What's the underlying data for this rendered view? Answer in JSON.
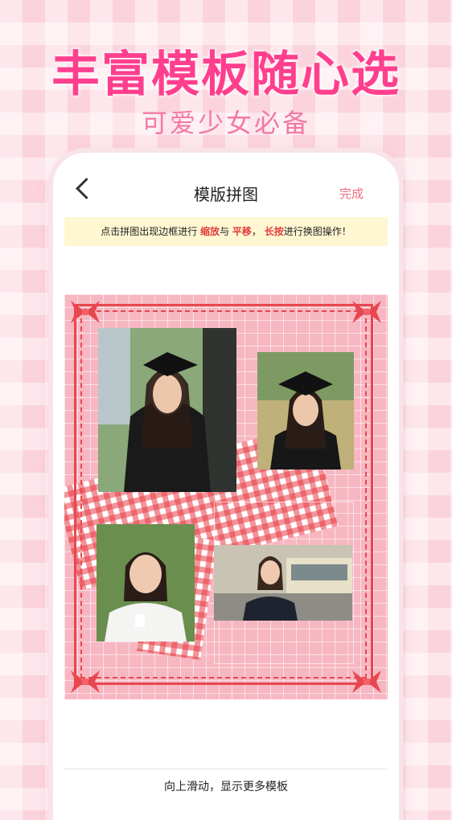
{
  "banner": {
    "headline": "丰富模板随心选",
    "subline": "可爱少女必备"
  },
  "navbar": {
    "title": "模版拼图",
    "done_label": "完成"
  },
  "tip": {
    "part1": "点击拼图出现边框进行 ",
    "zoom": "缩放",
    "part2": "与 ",
    "move": "平移",
    "part3": "， ",
    "longpress": "长按",
    "part4": "进行换图操作！"
  },
  "footer": {
    "hint": "向上滑动，显示更多模板"
  },
  "colors": {
    "accent_pink": "#ff3f8e",
    "done_red": "#ef6d7e",
    "tip_highlight": "#e23b3b",
    "frame_red": "#e8474f"
  }
}
